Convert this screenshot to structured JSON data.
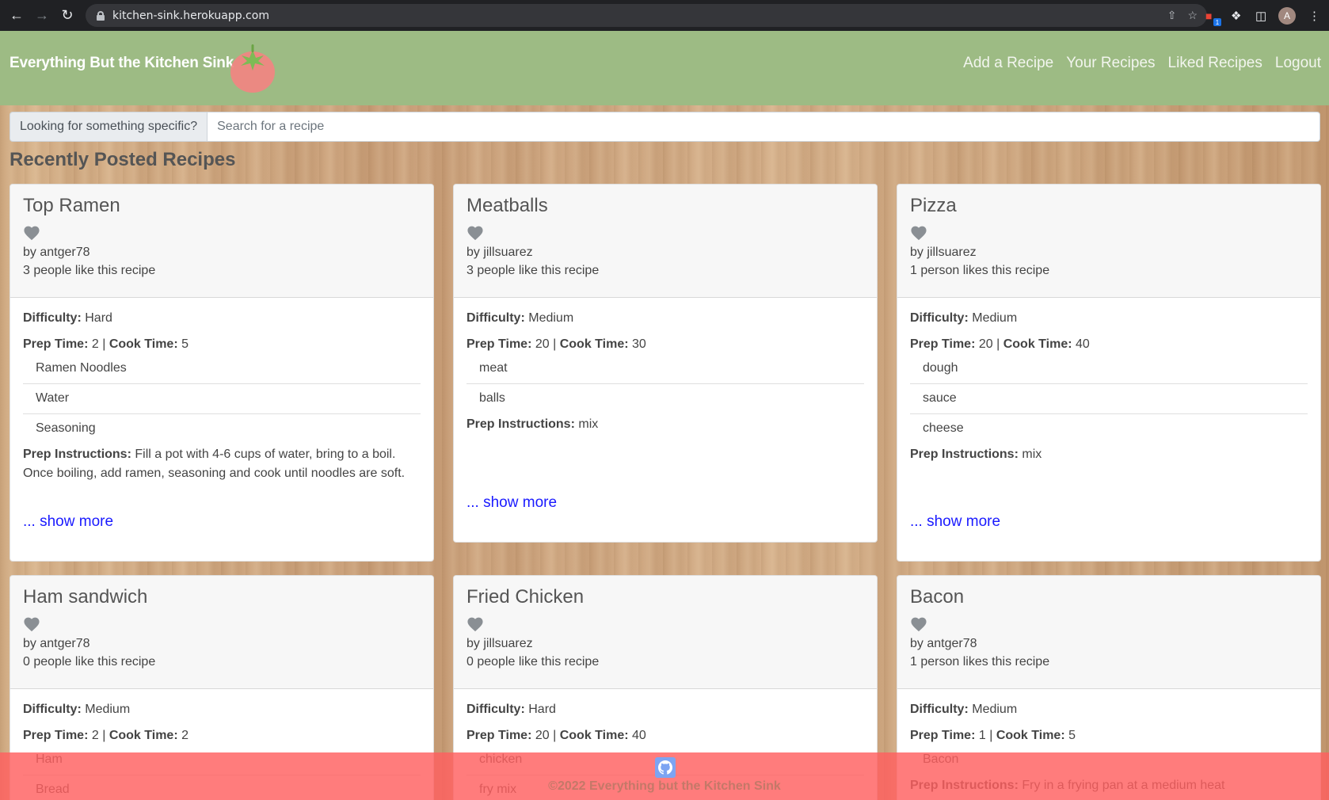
{
  "browser": {
    "url": "kitchen-sink.herokuapp.com",
    "avatar_initial": "A",
    "ext_badge": "1"
  },
  "navbar": {
    "brand": "Everything But the Kitchen Sink",
    "links": [
      "Add a Recipe",
      "Your Recipes",
      "Liked Recipes",
      "Logout"
    ]
  },
  "search": {
    "label": "Looking for something specific?",
    "placeholder": "Search for a recipe",
    "value": ""
  },
  "section_title": "Recently Posted Recipes",
  "labels": {
    "difficulty": "Difficulty:",
    "prep_time": "Prep Time:",
    "cook_time": "Cook Time:",
    "separator": "|",
    "prep_instructions": "Prep Instructions:",
    "show_more": "... show more"
  },
  "recipes": [
    {
      "title": "Top Ramen",
      "author": "by antger78",
      "likes": "3 people like this recipe",
      "difficulty": "Hard",
      "prep_time": "2",
      "cook_time": "5",
      "ingredients": [
        "Ramen Noodles",
        "Water",
        "Seasoning"
      ],
      "instructions": "Fill a pot with 4-6 cups of water, bring to a boil. Once boiling, add ramen, seasoning and cook until noodles are soft."
    },
    {
      "title": "Meatballs",
      "author": "by jillsuarez",
      "likes": "3 people like this recipe",
      "difficulty": "Medium",
      "prep_time": "20",
      "cook_time": "30",
      "ingredients": [
        "meat",
        "balls"
      ],
      "instructions": "mix"
    },
    {
      "title": "Pizza",
      "author": "by jillsuarez",
      "likes": "1 person likes this recipe",
      "difficulty": "Medium",
      "prep_time": "20",
      "cook_time": "40",
      "ingredients": [
        "dough",
        "sauce",
        "cheese"
      ],
      "instructions": "mix"
    },
    {
      "title": "Ham sandwich",
      "author": "by antger78",
      "likes": "0 people like this recipe",
      "difficulty": "Medium",
      "prep_time": "2",
      "cook_time": "2",
      "ingredients": [
        "Ham",
        "Bread"
      ],
      "instructions": ""
    },
    {
      "title": "Fried Chicken",
      "author": "by jillsuarez",
      "likes": "0 people like this recipe",
      "difficulty": "Hard",
      "prep_time": "20",
      "cook_time": "40",
      "ingredients": [
        "chicken",
        "fry mix"
      ],
      "instructions": ""
    },
    {
      "title": "Bacon",
      "author": "by antger78",
      "likes": "1 person likes this recipe",
      "difficulty": "Medium",
      "prep_time": "1",
      "cook_time": "5",
      "ingredients": [
        "Bacon"
      ],
      "instructions": "Fry in a frying pan at a medium heat"
    }
  ],
  "footer": {
    "text": "©2022 Everything but the Kitchen Sink",
    "icon": "github-icon"
  },
  "colors": {
    "navbar": "#9dbb84",
    "link": "#1a1aff",
    "footer": "#ff5f5f"
  }
}
